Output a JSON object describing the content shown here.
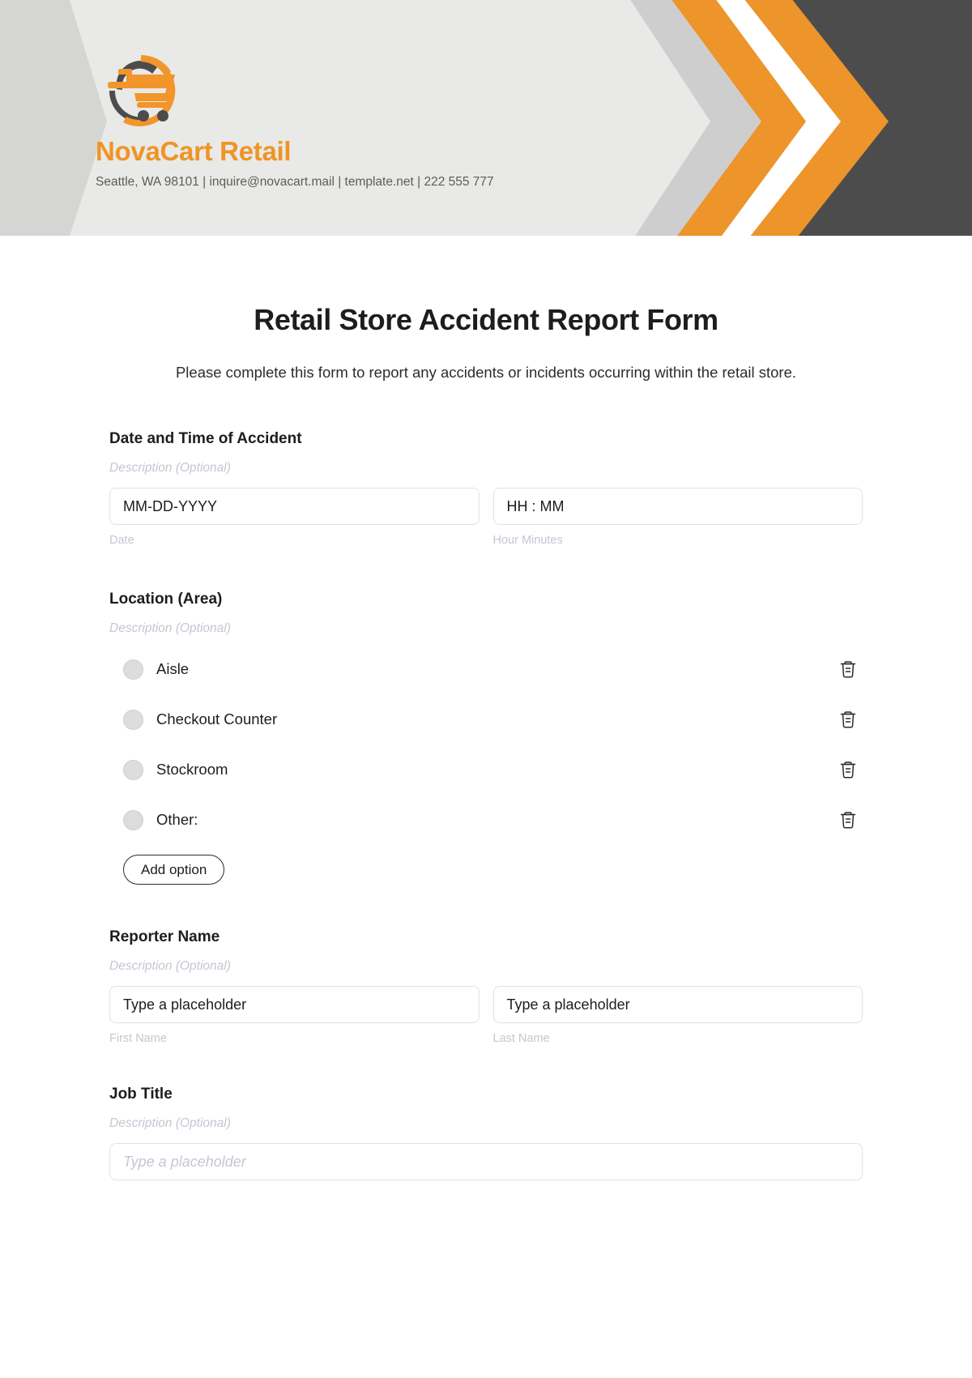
{
  "header": {
    "brand_name": "NovaCart Retail",
    "contact_line": "Seattle, WA 98101 | inquire@novacart.mail | template.net | 222 555 777",
    "logo_icon": "shopping-cart-icon",
    "colors": {
      "orange": "#ed942b",
      "dark": "#4c4c4c",
      "light_gray": "#e9e9e7",
      "mid_gray": "#cecece"
    }
  },
  "form": {
    "title": "Retail Store Accident Report Form",
    "subtitle": "Please complete this form to report any accidents or incidents occurring within the retail store.",
    "fields": [
      {
        "label": "Date and Time of Accident",
        "description": "Description (Optional)",
        "inputs": [
          {
            "value": "MM-DD-YYYY",
            "sub_label": "Date"
          },
          {
            "value": "HH : MM",
            "sub_label": "Hour Minutes"
          }
        ]
      },
      {
        "label": "Location (Area)",
        "description": "Description (Optional)",
        "options": [
          {
            "text": "Aisle",
            "delete_icon": "trash-icon"
          },
          {
            "text": "Checkout Counter",
            "delete_icon": "trash-icon"
          },
          {
            "text": "Stockroom",
            "delete_icon": "trash-icon"
          },
          {
            "text": "Other:",
            "delete_icon": "trash-icon"
          }
        ],
        "add_option_label": "Add option"
      },
      {
        "label": "Reporter Name",
        "description": "Description (Optional)",
        "inputs": [
          {
            "value": "Type a placeholder",
            "sub_label": "First Name"
          },
          {
            "value": "Type a placeholder",
            "sub_label": "Last Name"
          }
        ]
      },
      {
        "label": "Job Title",
        "description": "Description (Optional)",
        "inputs": [
          {
            "placeholder": "Type a placeholder"
          }
        ]
      }
    ]
  }
}
